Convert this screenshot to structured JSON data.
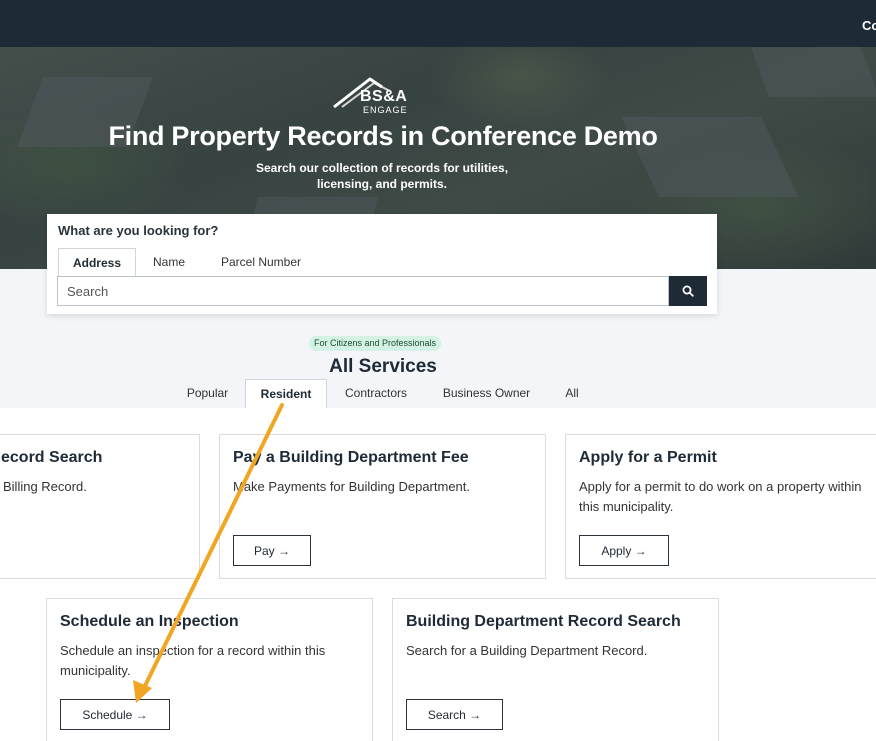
{
  "header": {
    "top_link": "Co"
  },
  "hero": {
    "logo_text": "BS&A",
    "logo_sub": "ENGAGE",
    "title": "Find Property Records in Conference Demo",
    "subtitle": "Search our collection of records for utilities, licensing, and permits."
  },
  "search": {
    "question": "What are you looking for?",
    "tabs": [
      {
        "label": "Address",
        "active": true
      },
      {
        "label": "Name",
        "active": false
      },
      {
        "label": "Parcel Number",
        "active": false
      }
    ],
    "placeholder": "Search",
    "button_icon": "search-icon"
  },
  "services": {
    "badge": "For Citizens and Professionals",
    "title": "All Services",
    "tabs": [
      {
        "label": "Popular",
        "active": false
      },
      {
        "label": "Resident",
        "active": true
      },
      {
        "label": "Contractors",
        "active": false
      },
      {
        "label": "Business Owner",
        "active": false
      },
      {
        "label": "All",
        "active": false
      }
    ],
    "cards": [
      {
        "title": "ecord Search",
        "desc": "Billing Record.",
        "button": ""
      },
      {
        "title": "Pay a Building Department Fee",
        "desc": "Make Payments for Building Department.",
        "button": "Pay →"
      },
      {
        "title": "Apply for a Permit",
        "desc": "Apply for a permit to do work on a property within this municipality.",
        "button": "Apply →"
      },
      {
        "title": "Schedule an Inspection",
        "desc": "Schedule an inspection for a record within this municipality.",
        "button": "Schedule →"
      },
      {
        "title": "Building Department Record Search",
        "desc": "Search for a Building Department Record.",
        "button": "Search →"
      }
    ]
  },
  "colors": {
    "header_bg": "#1f2a37",
    "badge_bg": "#d3f2e4",
    "arrow": "#f0a623"
  }
}
